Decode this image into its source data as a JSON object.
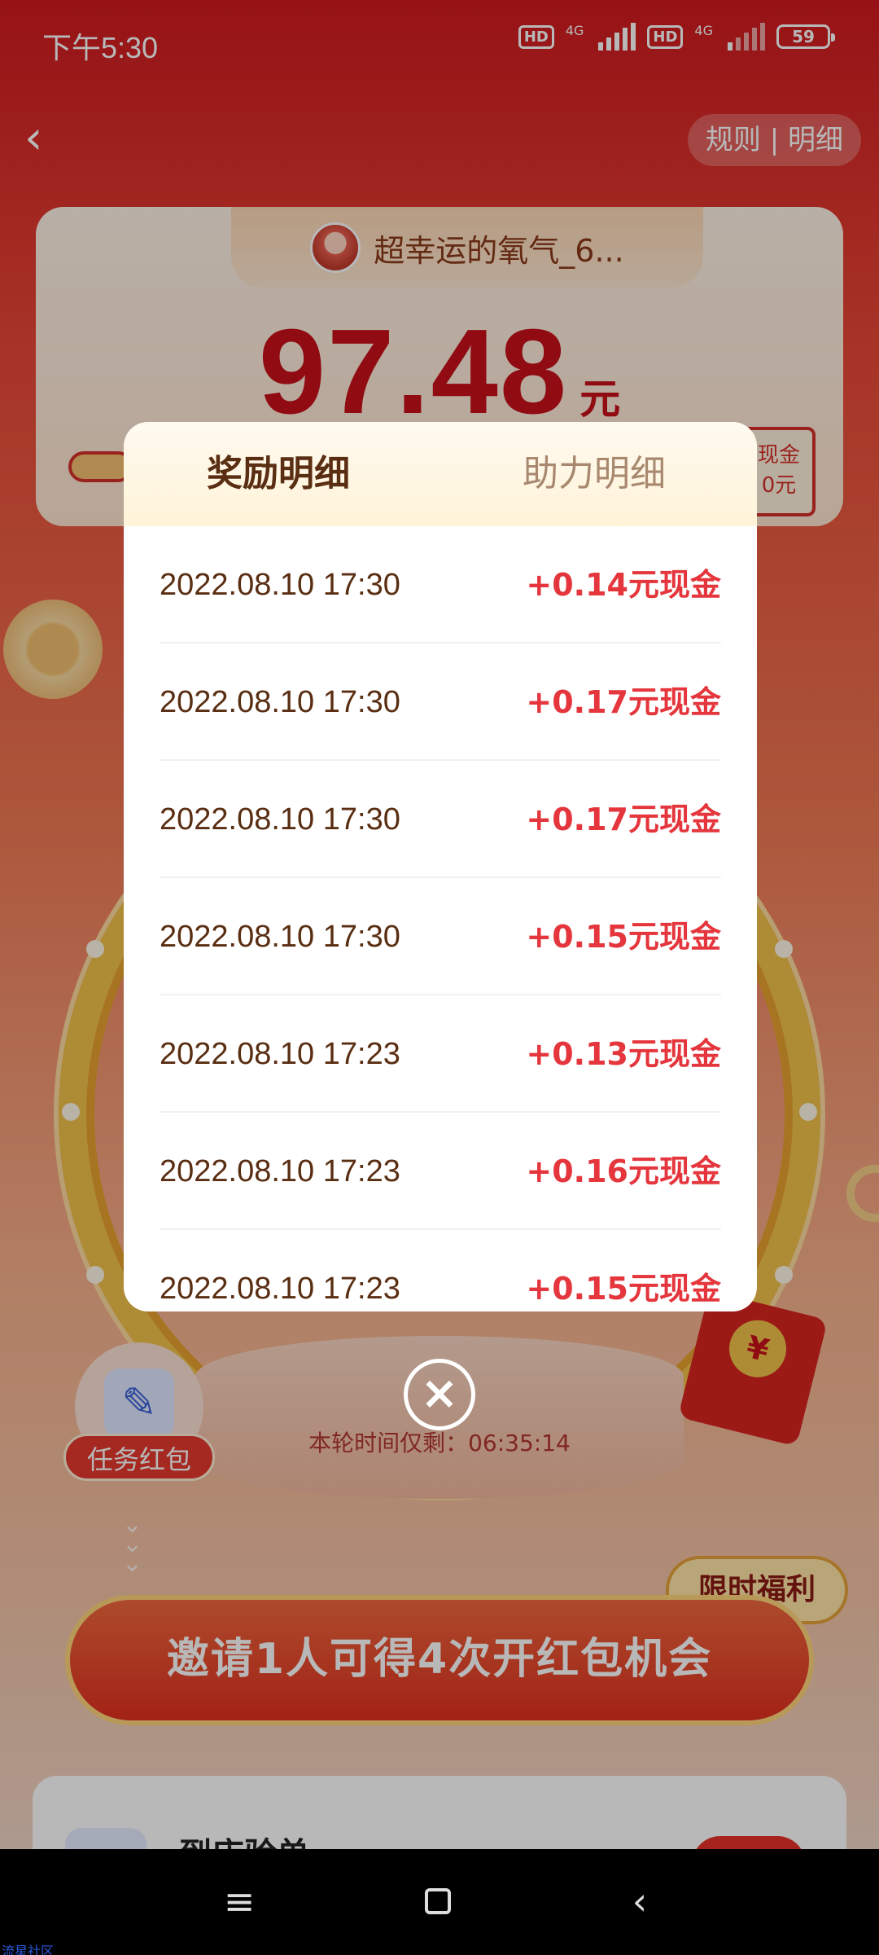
{
  "status_bar": {
    "time": "下午5:30",
    "hd_label": "HD",
    "network_1": "4G",
    "network_2": "4G",
    "battery": "59"
  },
  "header": {
    "rules_label": "规则 | 明细"
  },
  "summary": {
    "username": "超幸运的氧气_6...",
    "amount": "97.48",
    "unit": "元",
    "cash_label": "现金",
    "cash_value": "0元"
  },
  "modal": {
    "tabs": [
      {
        "label": "奖励明细",
        "active": true
      },
      {
        "label": "助力明细",
        "active": false
      }
    ],
    "rows": [
      {
        "time": "2022.08.10 17:30",
        "amount": "+0.14元现金"
      },
      {
        "time": "2022.08.10 17:30",
        "amount": "+0.17元现金"
      },
      {
        "time": "2022.08.10 17:30",
        "amount": "+0.17元现金"
      },
      {
        "time": "2022.08.10 17:30",
        "amount": "+0.15元现金"
      },
      {
        "time": "2022.08.10 17:23",
        "amount": "+0.13元现金"
      },
      {
        "time": "2022.08.10 17:23",
        "amount": "+0.16元现金"
      },
      {
        "time": "2022.08.10 17:23",
        "amount": "+0.15元现金"
      }
    ]
  },
  "background": {
    "task_label": "任务红包",
    "timer": "本轮时间仅剩：06:35:14",
    "limited_badge": "限时福利",
    "invite_button": "邀请1人可得4次开红包机会",
    "bottom_card_title": "到店验单",
    "envelope_glyph": "¥"
  },
  "watermark": "流星社区",
  "colors": {
    "accent_red": "#e4363c",
    "brand_red": "#c8101a",
    "tab_active": "#5a2e12",
    "tab_inactive": "#a8896f"
  },
  "icons": {
    "back": "chevron-left-icon",
    "close": "close-circle-icon",
    "nav_menu": "menu-icon",
    "nav_home": "home-square-icon",
    "nav_back": "back-triangle-icon"
  }
}
